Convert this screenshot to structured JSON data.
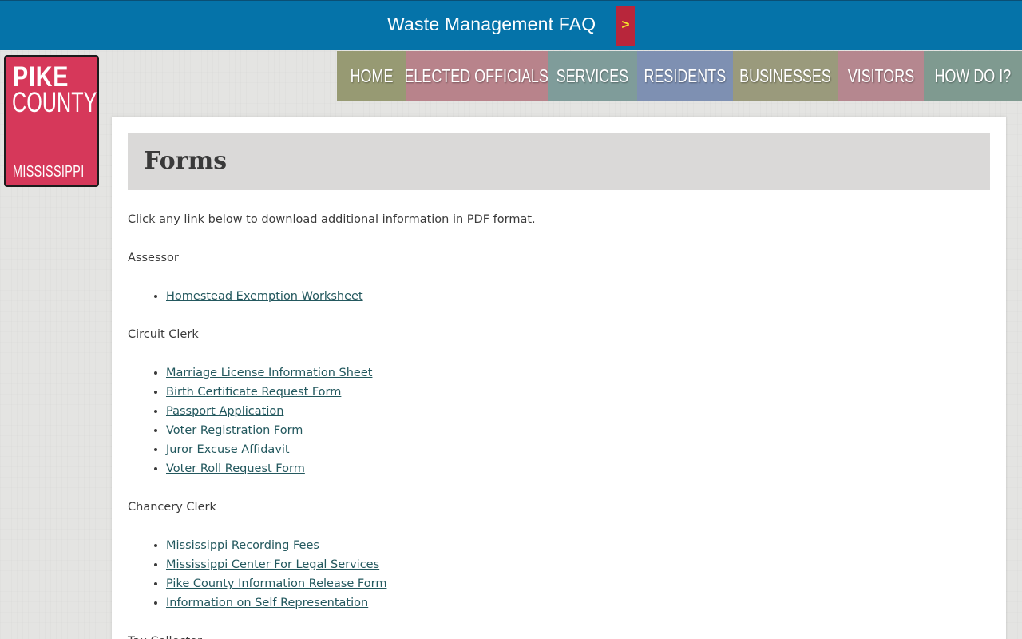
{
  "banner": {
    "text": "Waste Management FAQ",
    "arrow": ">"
  },
  "logo": {
    "line1": "PIKE",
    "line2": "COUNTY",
    "line3": "MISSISSIPPI"
  },
  "nav": [
    {
      "label": "HOME",
      "color": "#979a73",
      "width": 86
    },
    {
      "label": "ELECTED OFFICIALS",
      "color": "#b8838b",
      "width": 178
    },
    {
      "label": "SERVICES",
      "color": "#7f9c9a",
      "width": 112
    },
    {
      "label": "RESIDENTS",
      "color": "#7e90b2",
      "width": 120
    },
    {
      "label": "BUSINESSES",
      "color": "#9a9a7c",
      "width": 131
    },
    {
      "label": "VISITORS",
      "color": "#b5878f",
      "width": 108
    },
    {
      "label": "HOW DO I?",
      "color": "#7f9a90",
      "width": 123
    }
  ],
  "page": {
    "title": "Forms",
    "intro": "Click any link below to download additional information in PDF format."
  },
  "sections": [
    {
      "heading": "Assessor",
      "links": [
        "Homestead Exemption Worksheet"
      ]
    },
    {
      "heading": "Circuit Clerk",
      "links": [
        "Marriage License Information Sheet",
        "Birth Certificate Request Form",
        "Passport Application",
        "Voter Registration Form",
        "Juror Excuse Affidavit",
        "Voter Roll Request Form"
      ]
    },
    {
      "heading": "Chancery Clerk",
      "links": [
        "Mississippi Recording Fees",
        "Mississippi Center For Legal Services",
        "Pike County Information Release Form",
        "Information on Self Representation"
      ]
    },
    {
      "heading": "Tax Collector",
      "links": []
    }
  ]
}
